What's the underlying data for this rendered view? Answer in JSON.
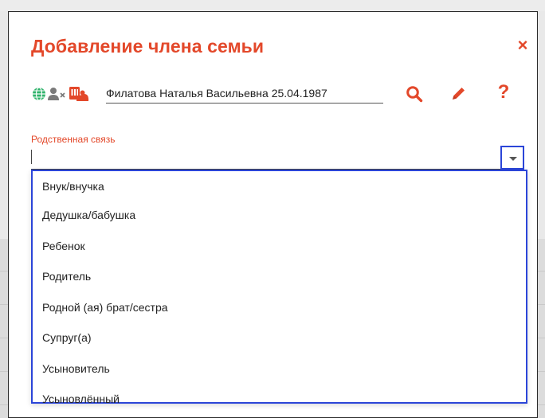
{
  "modal": {
    "title": "Добавление члена семьи",
    "close_label": "×"
  },
  "person": {
    "value": "Филатова Наталья Васильевна 25.04.1987",
    "icons": [
      "globe-icon",
      "user-remove-icon",
      "card-icon"
    ],
    "actions": {
      "search_icon": "search-icon",
      "edit_icon": "pencil-icon",
      "help_label": "?"
    }
  },
  "relationship": {
    "label": "Родственная связь",
    "value": "",
    "options": [
      "Внук/внучка",
      "Дедушка/бабушка",
      "Ребенок",
      "Родитель",
      "Родной (ая) брат/сестра",
      "Супруг(а)",
      "Усыновитель",
      "Усыновлённый"
    ]
  },
  "colors": {
    "accent": "#e3482a",
    "focus": "#2b45d8",
    "globe": "#2fb36b",
    "user_icon": "#7a7a7a"
  }
}
